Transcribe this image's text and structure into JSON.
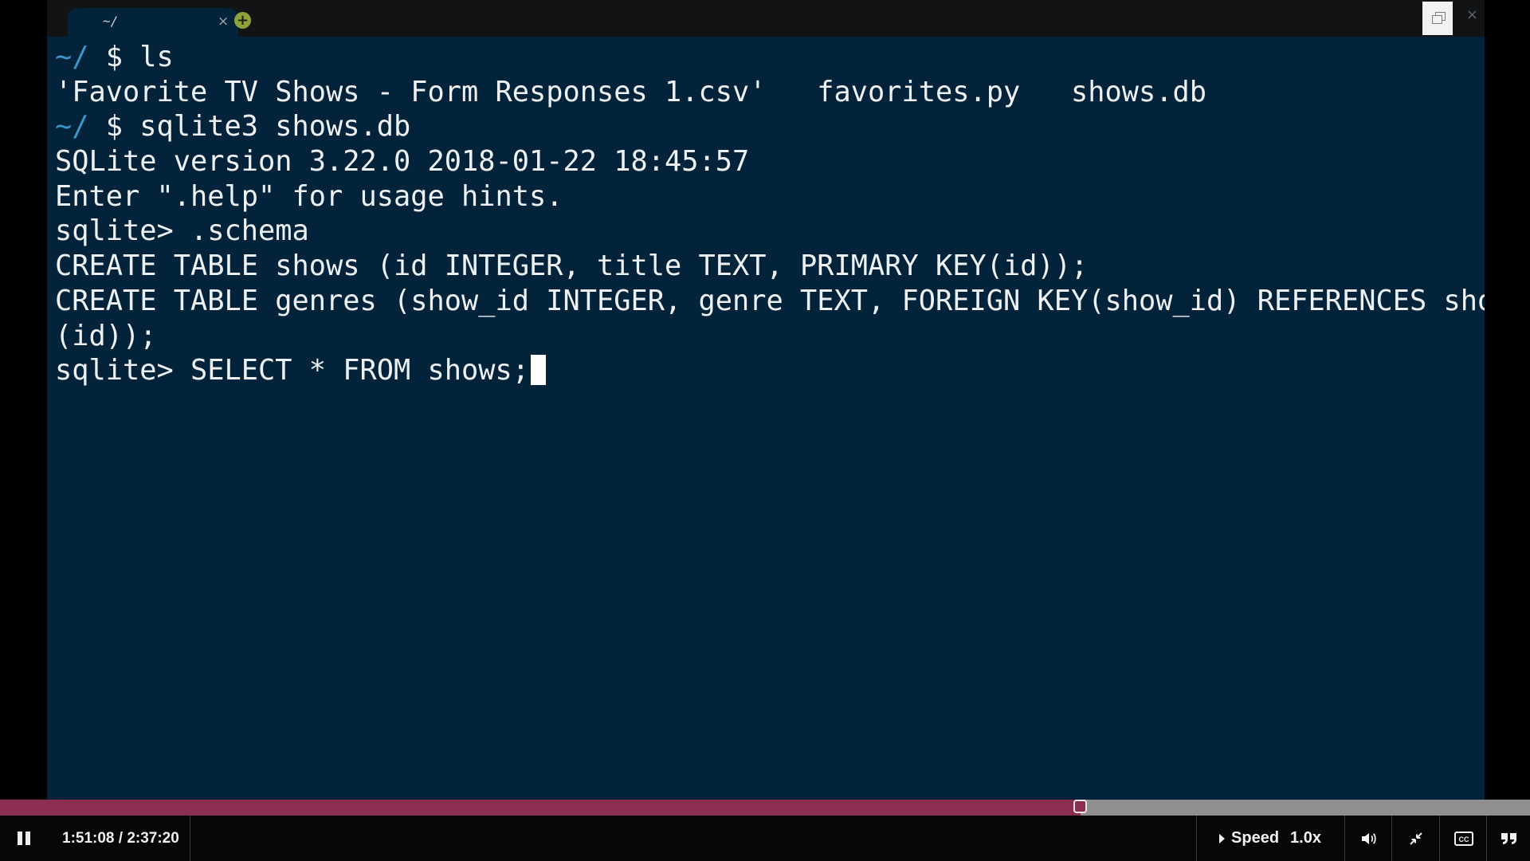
{
  "terminal": {
    "tab_title": "~/",
    "tab_close": "×",
    "new_tab": "+",
    "close_window": "×",
    "lines": [
      {
        "path": "~/",
        "text": " $ ls"
      },
      {
        "text": "'Favorite TV Shows - Form Responses 1.csv'   favorites.py   shows.db"
      },
      {
        "path": "~/",
        "text": " $ sqlite3 shows.db"
      },
      {
        "text": "SQLite version 3.22.0 2018-01-22 18:45:57"
      },
      {
        "text": "Enter \".help\" for usage hints."
      },
      {
        "text": "sqlite> .schema"
      },
      {
        "text": "CREATE TABLE shows (id INTEGER, title TEXT, PRIMARY KEY(id));"
      },
      {
        "text": "CREATE TABLE genres (show_id INTEGER, genre TEXT, FOREIGN KEY(show_id) REFERENCES shows"
      },
      {
        "text": "(id));"
      },
      {
        "text": "sqlite> SELECT * FROM shows;",
        "cursor": true
      }
    ]
  },
  "player": {
    "current_time": "1:51:08",
    "duration": "2:37:20",
    "time_display": "1:51:08 / 2:37:20",
    "progress_fraction": 0.7065,
    "speed_label": "Speed",
    "speed_value": "1.0x",
    "colors": {
      "progress": "#8c2e51",
      "track": "#8f8f8f"
    },
    "icons": [
      "pause-icon",
      "volume-icon",
      "exit-fullscreen-icon",
      "closed-captions-icon",
      "transcript-quote-icon"
    ]
  }
}
